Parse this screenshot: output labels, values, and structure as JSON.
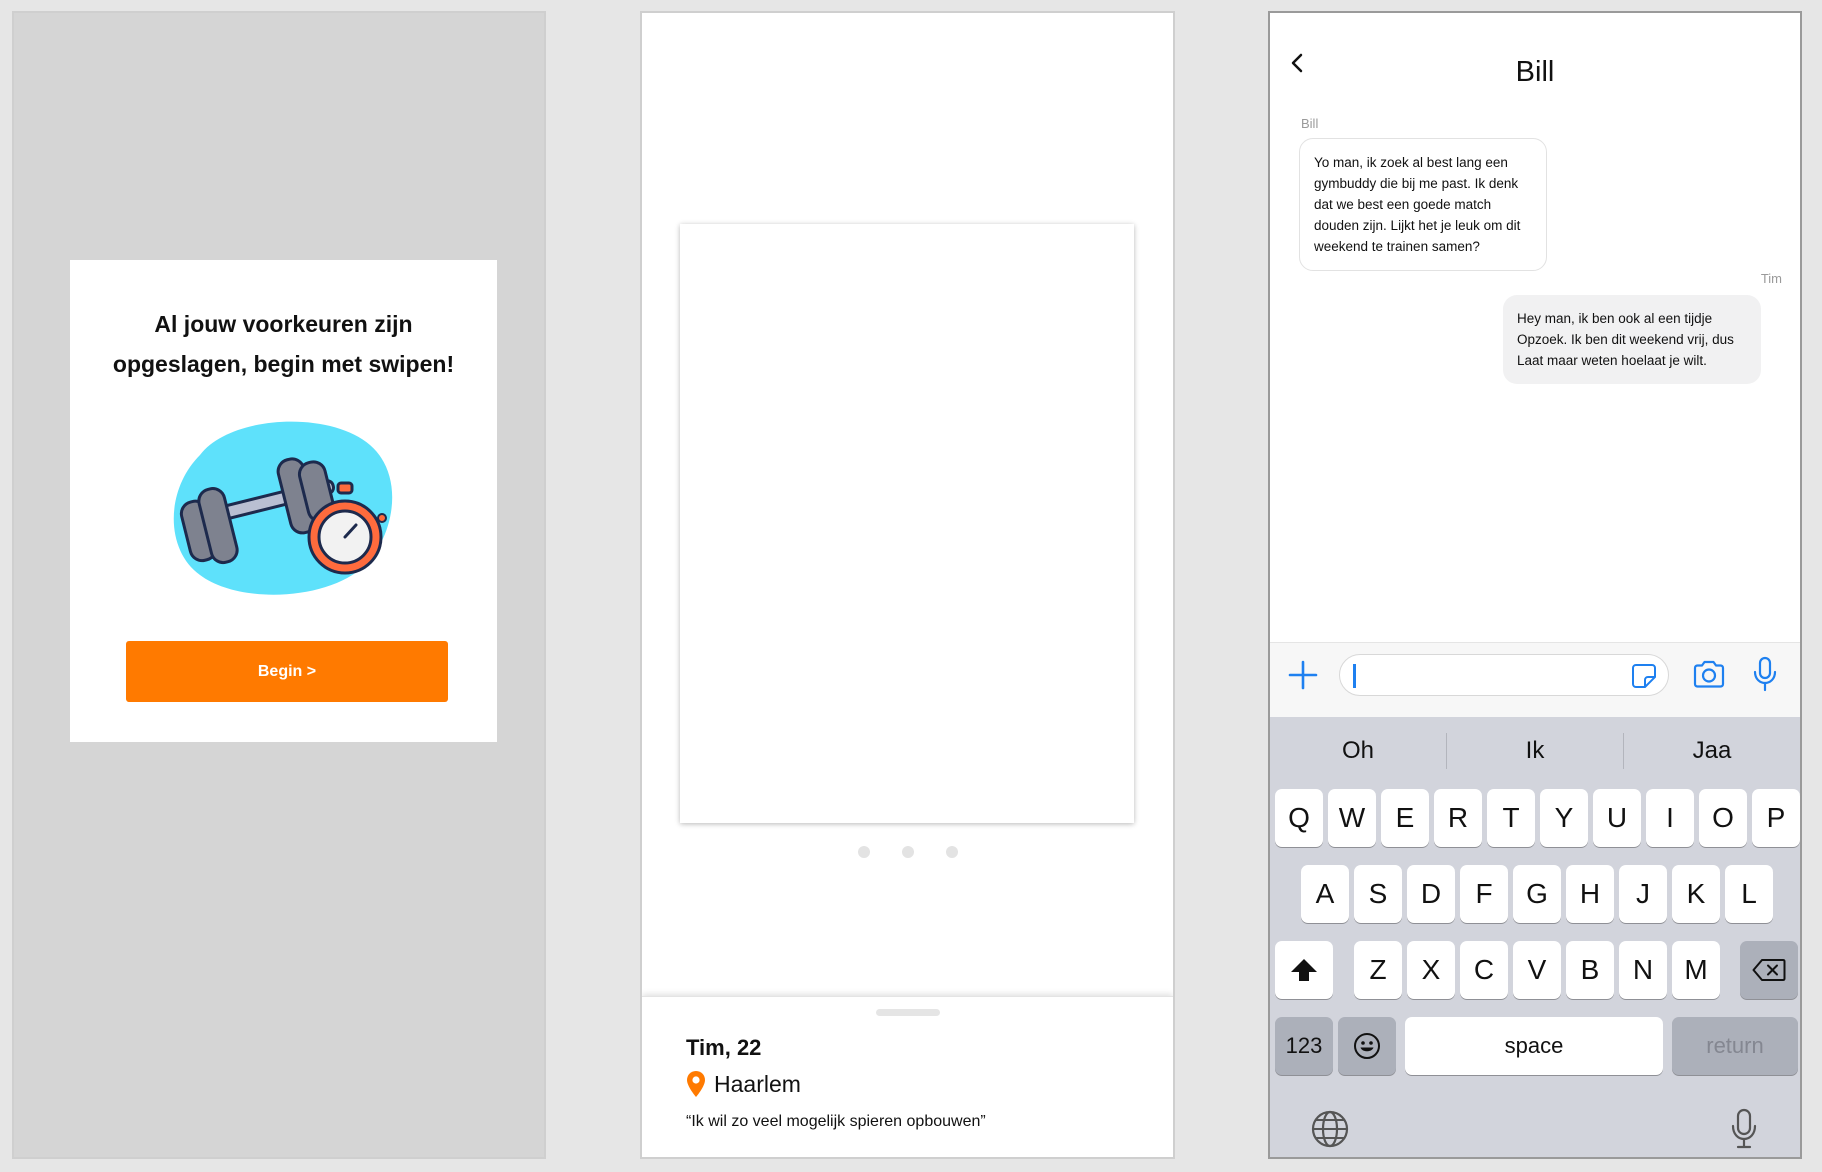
{
  "screen1": {
    "title": "Al jouw voorkeuren zijn opgeslagen, begin met swipen!",
    "illustration": "dumbbell-stopwatch-illustration",
    "begin_label": "Begin >",
    "accent": "#ff7a00"
  },
  "screen2": {
    "profile": {
      "name_age": "Tim, 22",
      "location": "Haarlem",
      "quote": "“Ik wil zo veel mogelijk spieren opbouwen”"
    },
    "pager_dots": 3,
    "location_icon": "location-pin-icon"
  },
  "screen3": {
    "title": "Bill",
    "messages": [
      {
        "sender": "Bill",
        "text": "Yo man, ik zoek al best lang een gymbuddy die bij me past. Ik denk dat we best een goede match douden zijn. Lijkt het je leuk om dit weekend te trainen samen?"
      },
      {
        "sender": "Tim",
        "text": "Hey man, ik ben ook al een tijdje Opzoek. Ik ben dit weekend vrij, dus Laat maar weten hoelaat je wilt."
      }
    ],
    "input_value": "",
    "suggestions": [
      "Oh",
      "Ik",
      "Jaa"
    ],
    "keyboard": {
      "row1": [
        "Q",
        "W",
        "E",
        "R",
        "T",
        "Y",
        "U",
        "I",
        "O",
        "P"
      ],
      "row2": [
        "A",
        "S",
        "D",
        "F",
        "G",
        "H",
        "J",
        "K",
        "L"
      ],
      "row3": [
        "Z",
        "X",
        "C",
        "V",
        "B",
        "N",
        "M"
      ],
      "numbers_label": "123",
      "space_label": "space",
      "return_label": "return"
    },
    "accent": "#1e80f0"
  }
}
